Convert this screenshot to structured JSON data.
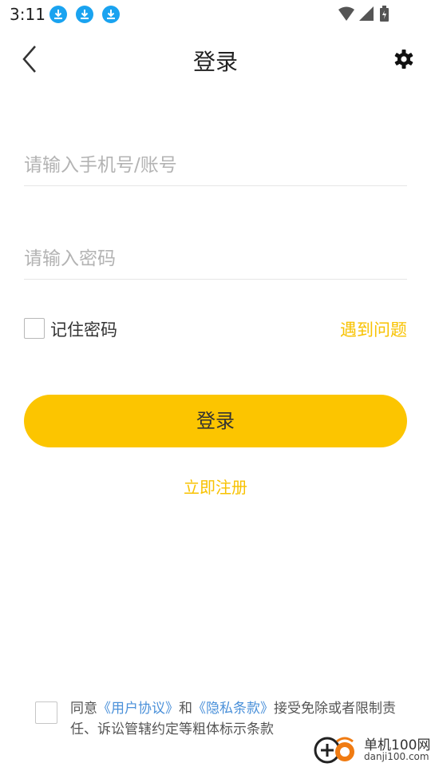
{
  "status_bar": {
    "time": "3:11",
    "download_icons": [
      "download-icon",
      "download-icon",
      "download-icon"
    ],
    "indicators": [
      "wifi-icon",
      "signal-icon",
      "battery-icon"
    ]
  },
  "header": {
    "title": "登录",
    "back_icon": "chevron-left-icon",
    "settings_icon": "gear-icon"
  },
  "form": {
    "account_placeholder": "请输入手机号/账号",
    "account_value": "",
    "password_placeholder": "请输入密码",
    "password_value": "",
    "remember_label": "记住密码",
    "remember_checked": false,
    "problem_link": "遇到问题",
    "login_button": "登录",
    "register_link": "立即注册"
  },
  "agreement": {
    "prefix": "同意",
    "user_agreement": "《用户协议》",
    "and": "和",
    "privacy_policy": "《隐私条款》",
    "suffix": "接受免除或者限制责任、诉讼管辖约定等粗体标示条款",
    "checked": false
  },
  "watermark": {
    "name": "单机100网",
    "domain": "danji100.com"
  },
  "colors": {
    "accent": "#fcc500",
    "link_yellow": "#f8c200",
    "link_blue": "#4a90d9",
    "download_blue": "#1aa3f0"
  }
}
